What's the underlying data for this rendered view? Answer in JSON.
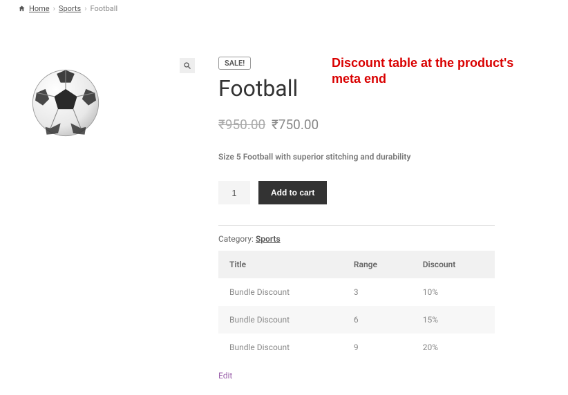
{
  "breadcrumb": {
    "home": "Home",
    "cat": "Sports",
    "current": "Football"
  },
  "product": {
    "sale_badge": "SALE!",
    "title": "Football",
    "currency": "₹",
    "old_price": "950.00",
    "new_price": "750.00",
    "short_desc": "Size 5 Football with superior stitching and durability",
    "qty": "1",
    "add_to_cart": "Add to cart",
    "category_label": "Category: ",
    "category_link": "Sports",
    "edit": "Edit"
  },
  "discount_table": {
    "headers": {
      "title": "Title",
      "range": "Range",
      "discount": "Discount"
    },
    "rows": [
      {
        "title": "Bundle Discount",
        "range": "3",
        "discount": "10%"
      },
      {
        "title": "Bundle Discount",
        "range": "6",
        "discount": "15%"
      },
      {
        "title": "Bundle Discount",
        "range": "9",
        "discount": "20%"
      }
    ]
  },
  "annotation": "Discount table at the product's meta end"
}
